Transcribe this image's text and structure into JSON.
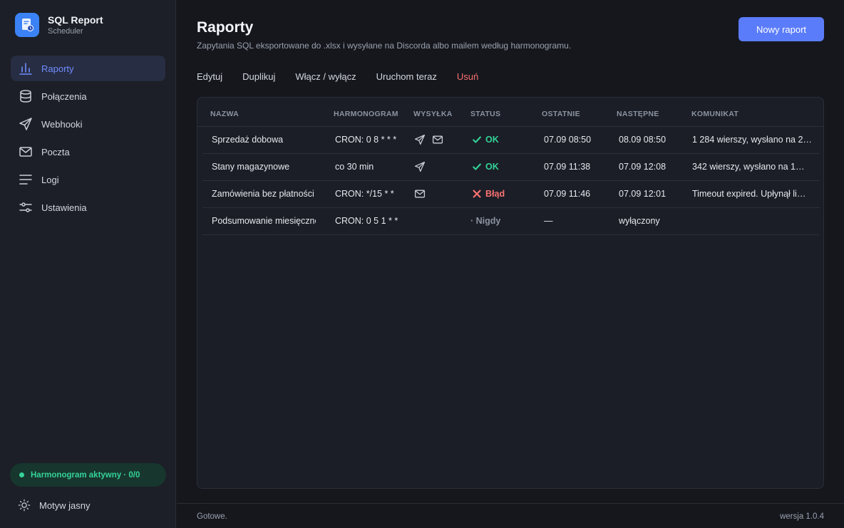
{
  "app": {
    "title": "SQL Report",
    "subtitle": "Scheduler"
  },
  "sidebar": {
    "items": [
      {
        "label": "Raporty",
        "icon": "bar-chart-icon",
        "active": true
      },
      {
        "label": "Połączenia",
        "icon": "database-icon"
      },
      {
        "label": "Webhooki",
        "icon": "send-icon"
      },
      {
        "label": "Poczta",
        "icon": "mail-icon"
      },
      {
        "label": "Logi",
        "icon": "list-icon"
      },
      {
        "label": "Ustawienia",
        "icon": "sliders-icon"
      }
    ],
    "schedule_status": "Harmonogram aktywny · 0/0",
    "theme_label": "Motyw jasny"
  },
  "header": {
    "title": "Raporty",
    "subtitle": "Zapytania SQL eksportowane do .xlsx i wysyłane na Discorda albo mailem według harmonogramu.",
    "new_button": "Nowy raport"
  },
  "toolbar": {
    "edit": "Edytuj",
    "duplicate": "Duplikuj",
    "toggle": "Włącz / wyłącz",
    "run_now": "Uruchom teraz",
    "delete": "Usuń"
  },
  "table": {
    "columns": [
      "NAZWA",
      "HARMONOGRAM",
      "WYSYŁKA",
      "STATUS",
      "OSTATNIE",
      "NASTĘPNE",
      "KOMUNIKAT"
    ],
    "rows": [
      {
        "name": "Sprzedaż dobowa",
        "schedule": "CRON: 0 8 * * *",
        "discord": true,
        "mail": true,
        "status": "OK",
        "status_kind": "ok",
        "last": "07.09 08:50",
        "next": "08.09 08:50",
        "message": "1 284 wierszy, wysłano na 2…"
      },
      {
        "name": "Stany magazynowe",
        "schedule": "co 30 min",
        "discord": true,
        "mail": false,
        "status": "OK",
        "status_kind": "ok",
        "last": "07.09 11:38",
        "next": "07.09 12:08",
        "message": "342 wierszy, wysłano na 1…"
      },
      {
        "name": "Zamówienia bez płatności",
        "schedule": "CRON: */15 * *",
        "discord": false,
        "mail": true,
        "status": "Błąd",
        "status_kind": "err",
        "last": "07.09 11:46",
        "next": "07.09 12:01",
        "message": "Timeout expired. Upłynął li…"
      },
      {
        "name": "Podsumowanie miesięczne",
        "schedule": "CRON: 0 5 1 * *",
        "discord": false,
        "mail": false,
        "status": "· Nigdy",
        "status_kind": "never",
        "last": "—",
        "next": "wyłączony",
        "message": ""
      }
    ]
  },
  "footer": {
    "status": "Gotowe.",
    "version": "wersja 1.0.4"
  }
}
